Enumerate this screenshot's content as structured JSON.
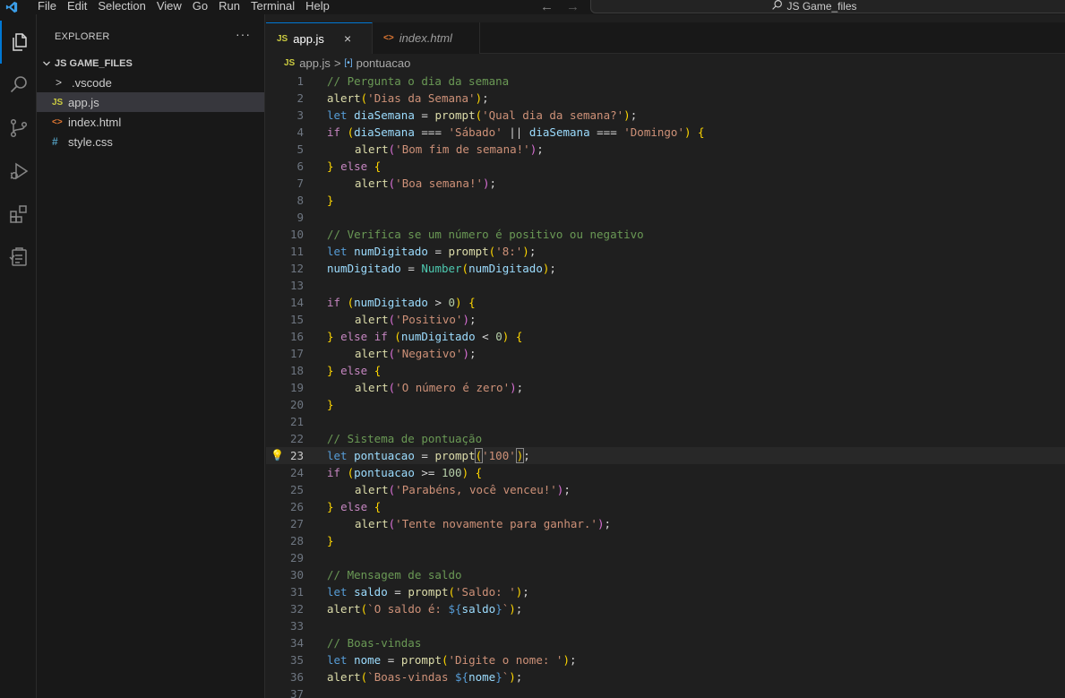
{
  "menu": [
    "File",
    "Edit",
    "Selection",
    "View",
    "Go",
    "Run",
    "Terminal",
    "Help"
  ],
  "command_center": "JS Game_files",
  "explorer": {
    "title": "EXPLORER",
    "more": "···",
    "folder": "JS GAME_FILES",
    "items": [
      {
        "label": ".vscode",
        "icon": "chevron-right-icon",
        "glyph": ">"
      },
      {
        "label": "app.js",
        "icon": "js-file-icon",
        "glyph": "JS"
      },
      {
        "label": "index.html",
        "icon": "html-file-icon",
        "glyph": "<>"
      },
      {
        "label": "style.css",
        "icon": "css-file-icon",
        "glyph": "#"
      }
    ]
  },
  "tabs": [
    {
      "label": "app.js",
      "glyph": "JS",
      "close": "×"
    },
    {
      "label": "index.html",
      "glyph": "<>"
    }
  ],
  "breadcrumb": {
    "file_glyph": "JS",
    "file": "app.js",
    "sep": ">",
    "symbol_glyph": "[•]",
    "symbol": "pontuacao"
  },
  "current_line": 23,
  "code_lines": [
    "// Pergunta o dia da semana",
    "alert('Dias da Semana');",
    "let diaSemana = prompt('Qual dia da semana?');",
    "if (diaSemana === 'Sábado' || diaSemana === 'Domingo') {",
    "    alert('Bom fim de semana!');",
    "} else {",
    "    alert('Boa semana!');",
    "}",
    "",
    "// Verifica se um número é positivo ou negativo",
    "let numDigitado = prompt('8:');",
    "numDigitado = Number(numDigitado);",
    "",
    "if (numDigitado > 0) {",
    "    alert('Positivo');",
    "} else if (numDigitado < 0) {",
    "    alert('Negativo');",
    "} else {",
    "    alert('O número é zero');",
    "}",
    "",
    "// Sistema de pontuação",
    "let pontuacao = prompt('100');",
    "if (pontuacao >= 100) {",
    "    alert('Parabéns, você venceu!');",
    "} else {",
    "    alert('Tente novamente para ganhar.');",
    "}",
    "",
    "// Mensagem de saldo",
    "let saldo = prompt('Saldo: ');",
    "alert(`O saldo é: ${saldo}`);",
    "",
    "// Boas-vindas",
    "let nome = prompt('Digite o nome: ');",
    "alert(`Boas-vindas ${nome}`);",
    ""
  ],
  "colors": {
    "accent": "#0078d4",
    "editor_bg": "#1f1f1f",
    "sidebar_bg": "#181818",
    "js_icon": "#cbcb41",
    "html_icon": "#e37933",
    "css_icon": "#519aba"
  }
}
